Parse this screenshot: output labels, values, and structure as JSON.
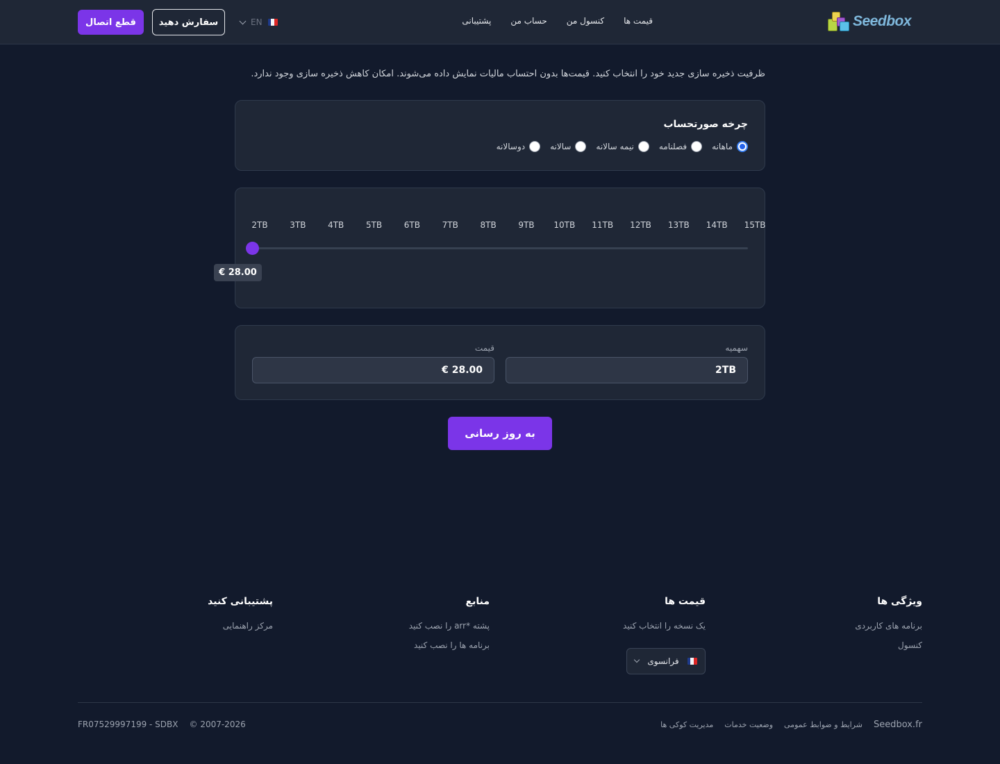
{
  "header": {
    "logo_text": "Seedbox",
    "nav": [
      "قیمت ها",
      "کنسول من",
      "حساب من",
      "پشتیبانی"
    ],
    "disconnect_label": "قطع اتصال",
    "order_label": "سفارش دهید",
    "language": "EN"
  },
  "intro_text": "ظرفیت ذخیره سازی جدید خود را انتخاب کنید. قیمت‌ها بدون احتساب مالیات نمایش داده می‌شوند. امکان کاهش ذخیره سازی وجود ندارد.",
  "billing": {
    "title": "چرخه صورتحساب",
    "options": [
      "ماهانه",
      "فصلنامه",
      "نیمه سالانه",
      "سالانه",
      "دوسالانه"
    ],
    "selected": "ماهانه"
  },
  "slider": {
    "ticks": [
      "2TB",
      "3TB",
      "4TB",
      "5TB",
      "6TB",
      "7TB",
      "8TB",
      "9TB",
      "10TB",
      "11TB",
      "12TB",
      "13TB",
      "14TB",
      "15TB"
    ],
    "value": "2TB",
    "price_tooltip": "€ 28.00"
  },
  "fields": {
    "quota_label": "سهمیه",
    "quota_value": "2TB",
    "price_label": "قیمت",
    "price_value": "€ 28.00"
  },
  "update_label": "به روز رسانی",
  "footer": {
    "features": {
      "title": "ویژگی ها",
      "links": [
        "برنامه های کاربردی",
        "کنسول"
      ]
    },
    "pricing": {
      "title": "قیمت ها",
      "links": [
        "یک نسخه را انتخاب کنید"
      ]
    },
    "resources": {
      "title": "منابع",
      "links": [
        "پشته *arr را نصب کنید",
        "برنامه ها را نصب کنید"
      ]
    },
    "support": {
      "title": "پشتیبانی کنید",
      "links": [
        "مرکز راهنمایی"
      ]
    },
    "locale_label": "فرانسوی",
    "brand": "Seedbox.fr",
    "legal_links": [
      "شرایط و ضوابط عمومی",
      "وضعیت خدمات",
      "مدیریت کوکی ها"
    ],
    "copyright": "© 2007-2026",
    "company_id": "FR07529997199 - SDBX"
  },
  "colors": {
    "accent": "#7b35e8",
    "background": "#121a2c",
    "card": "#1f2736"
  }
}
